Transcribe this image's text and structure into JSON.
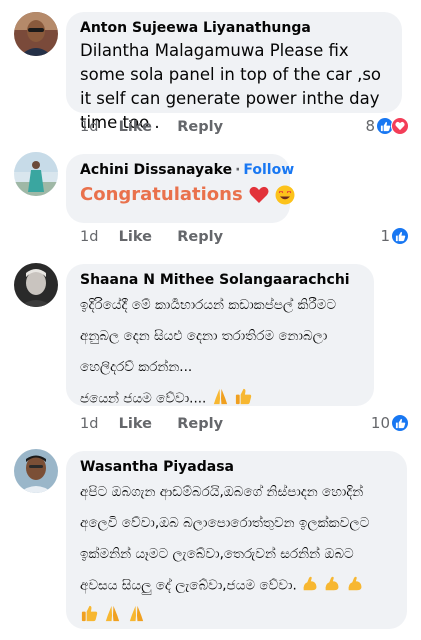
{
  "comments": [
    {
      "author": "Anton Sujeewa Liyanathunga",
      "text": "Dilantha Malagamuwa  Please fix  some sola panel in top of the car ,so it self can generate power inthe day time too .",
      "time": "1d",
      "like": "Like",
      "reply": "Reply",
      "reaction_count": "8",
      "reactions": [
        "like-icon",
        "love-icon"
      ]
    },
    {
      "author": "Achini Dissanayake",
      "follow": "Follow",
      "separator": "·",
      "text": "Congratulations",
      "emojis": [
        "red-heart-icon",
        "heart-eyes-icon"
      ],
      "time": "1d",
      "like": "Like",
      "reply": "Reply",
      "reaction_count": "1",
      "reactions": [
        "like-icon"
      ]
    },
    {
      "author": "Shaana N Mithee Solangaarachchi",
      "lines": [
        "ඉදිරියේදී මේ කාර්‍යභාරයන් කඩාකප්පල් කිරීමට",
        "අනුබල දෙන සියළු දෙනා තරාතිරම නොබලා",
        "හෙලිදරව් කරන්න...",
        "ජයෙන් ජයම වේවා...."
      ],
      "emojis": [
        "folded-hands-icon",
        "thumbs-up-icon"
      ],
      "time": "1d",
      "like": "Like",
      "reply": "Reply",
      "reaction_count": "10",
      "reactions": [
        "like-icon"
      ]
    },
    {
      "author": "Wasantha Piyadasa",
      "lines": [
        "අපිට ඔබගැන ආඩම්බරයි,ඔබගේ නිස්පාදන හොදින්",
        "අලෙවි වේවා,ඔබ බලාපොරොත්තුවන ඉලක්කවලට",
        "ඉක්මනින් යෑමට ලැබේවා,තෙරුවන් සරනින් ඔබට",
        "අවසය සියලු දේ ලැබේවා,ජයම වේවා."
      ],
      "emojis_line4": [
        "flexed-biceps-icon",
        "flexed-biceps-icon",
        "flexed-biceps-icon"
      ],
      "emojis_line5": [
        "thumbs-up-icon",
        "folded-hands-icon",
        "folded-hands-icon"
      ]
    }
  ]
}
